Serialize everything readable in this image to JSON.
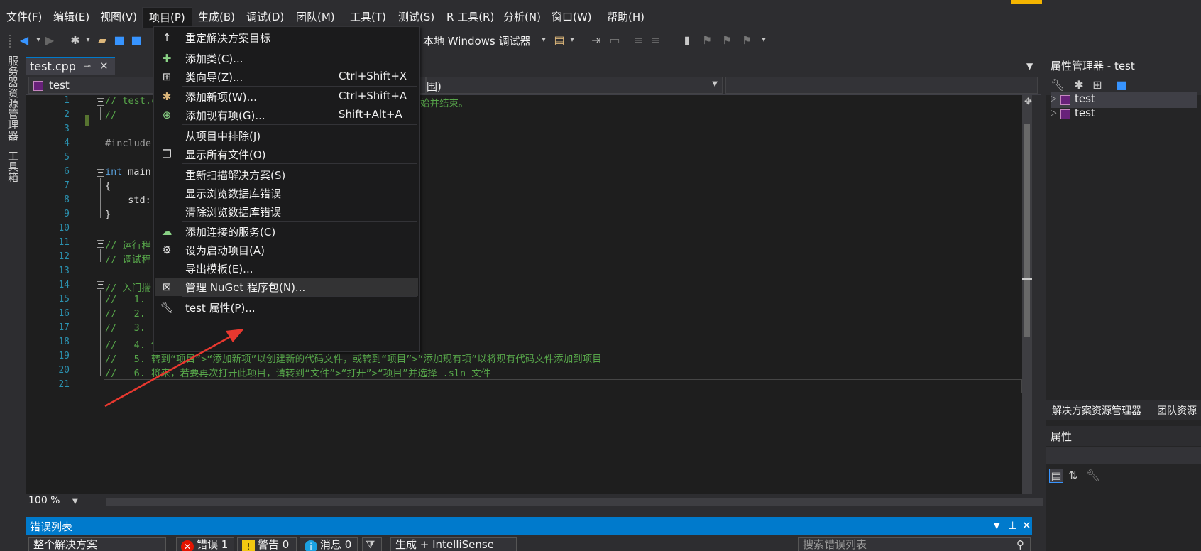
{
  "menubar": {
    "items": [
      "文件(F)",
      "编辑(E)",
      "视图(V)",
      "项目(P)",
      "生成(B)",
      "调试(D)",
      "团队(M)",
      "工具(T)",
      "测试(S)",
      "R 工具(R)",
      "分析(N)",
      "窗口(W)",
      "帮助(H)"
    ]
  },
  "toolbar": {
    "debugger_label": "本地 Windows 调试器"
  },
  "left_tabs": [
    "服务器资源管理器",
    "工具箱"
  ],
  "document_tab": {
    "label": "test.cpp"
  },
  "navbar": {
    "project": "test",
    "scope_fragment": "围)"
  },
  "editor": {
    "line_numbers": [
      "1",
      "2",
      "3",
      "4",
      "5",
      "6",
      "7",
      "8",
      "9",
      "10",
      "11",
      "12",
      "13",
      "14",
      "15",
      "16",
      "17",
      "18",
      "19",
      "20",
      "21"
    ],
    "visible_code": {
      "l1a": "// test.c",
      "l1b": "始并结束。",
      "l2": "//",
      "l4": "#include",
      "l6k": "int",
      "l6": " main",
      "l7": "{",
      "l8": "  std:",
      "l9": "}",
      "l11": "// 运行程",
      "l12": "// 调试程",
      "l14": "// 入门揣",
      "l15": "//   1. ",
      "l16": "//   2. ",
      "l17": "//   3. ",
      "l18": "//   4. 使用错误列表窗口查看错误",
      "l19": "//   5. 转到“项目”>“添加新项”以创建新的代码文件，或转到“项目”>“添加现有项”以将现有代码文件添加到项目",
      "l20": "//   6. 将来，若要再次打开此项目，请转到“文件”>“打开”>“项目”并选择 .sln 文件"
    },
    "zoom": "100 %"
  },
  "right_panel": {
    "title": "属性管理器 - test",
    "tree": [
      "test",
      "test"
    ],
    "tabs": [
      "解决方案资源管理器",
      "团队资源"
    ],
    "properties_title": "属性"
  },
  "error_list": {
    "title": "错误列表",
    "scope": "整个解决方案",
    "errors": "错误 1",
    "warnings": "警告 0",
    "messages": "消息 0",
    "build_filter": "生成 + IntelliSense",
    "search_placeholder": "搜索错误列表"
  },
  "project_menu": {
    "items": [
      {
        "label": "重定解决方案目标",
        "shortcut": "",
        "icon": "arrow-up-icon"
      },
      {
        "label": "添加类(C)...",
        "shortcut": "",
        "icon": "add-class-icon"
      },
      {
        "label": "类向导(Z)...",
        "shortcut": "Ctrl+Shift+X",
        "icon": "class-wizard-icon"
      },
      {
        "label": "添加新项(W)...",
        "shortcut": "Ctrl+Shift+A",
        "icon": "add-new-item-icon"
      },
      {
        "label": "添加现有项(G)...",
        "shortcut": "Shift+Alt+A",
        "icon": "add-existing-item-icon"
      },
      {
        "label": "从项目中排除(J)",
        "shortcut": "",
        "icon": ""
      },
      {
        "label": "显示所有文件(O)",
        "shortcut": "",
        "icon": "show-all-files-icon"
      },
      {
        "label": "重新扫描解决方案(S)",
        "shortcut": "",
        "icon": ""
      },
      {
        "label": "显示浏览数据库错误",
        "shortcut": "",
        "icon": ""
      },
      {
        "label": "清除浏览数据库错误",
        "shortcut": "",
        "icon": ""
      },
      {
        "label": "添加连接的服务(C)",
        "shortcut": "",
        "icon": "connected-service-icon"
      },
      {
        "label": "设为启动项目(A)",
        "shortcut": "",
        "icon": "gear-icon"
      },
      {
        "label": "导出模板(E)...",
        "shortcut": "",
        "icon": ""
      },
      {
        "label": "管理 NuGet 程序包(N)...",
        "shortcut": "",
        "icon": "nuget-package-icon"
      },
      {
        "label": "test 属性(P)...",
        "shortcut": "",
        "icon": "wrench-icon"
      }
    ]
  },
  "colors": {
    "accent": "#007acc",
    "annotation_arrow": "#e8382f",
    "comment": "#57a64a",
    "keyword": "#569cd6"
  }
}
